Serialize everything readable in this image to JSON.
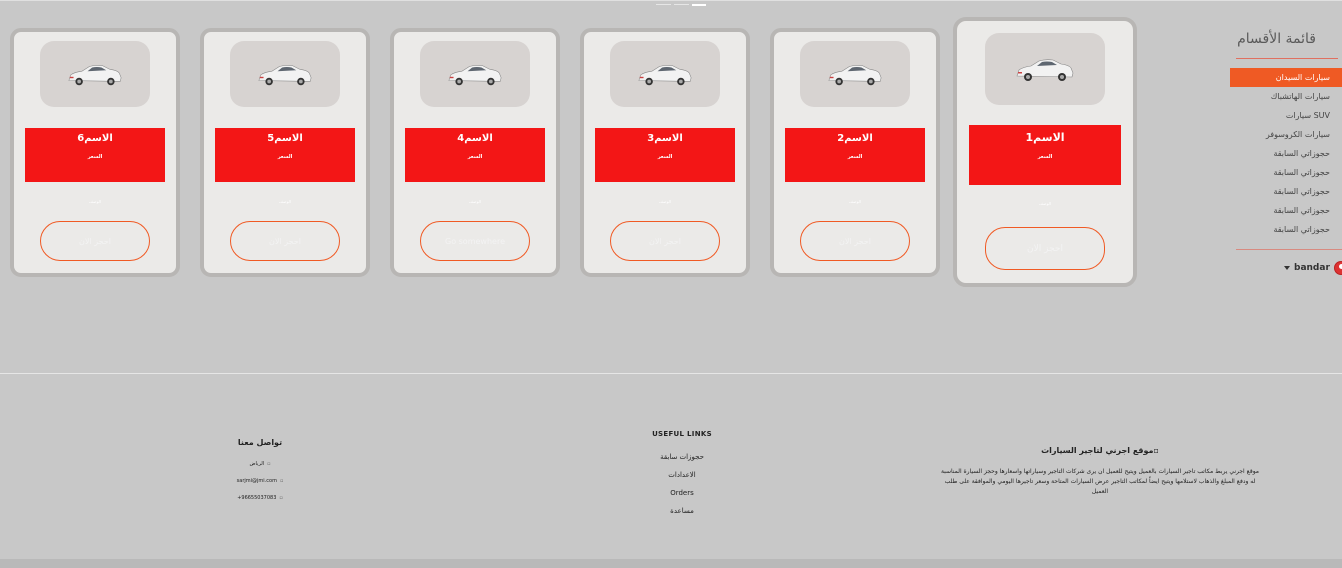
{
  "sidebar": {
    "title": "قائمة الأقسام",
    "items": [
      {
        "label": "سيارات السيدان",
        "active": true
      },
      {
        "label": "سيارات الهاتشباك",
        "active": false
      },
      {
        "label": "سيارات SUV",
        "active": false
      },
      {
        "label": "سيارات الكروسوفر",
        "active": false
      },
      {
        "label": "حجوزاتي السابقة",
        "active": false
      },
      {
        "label": "حجوزاتي السابقة",
        "active": false
      },
      {
        "label": "حجوزاتي السابقة",
        "active": false
      },
      {
        "label": "حجوزاتي السابقة",
        "active": false
      },
      {
        "label": "حجوزاتي السابقة",
        "active": false
      }
    ]
  },
  "user": {
    "name": "bandar",
    "avatar_icon": "user-avatar-icon",
    "dropdown_icon": "caret-down-icon"
  },
  "cards": [
    {
      "name": "الاسم1",
      "price": "السعر",
      "desc": "الوصف",
      "button": "احجز الان"
    },
    {
      "name": "الاسم2",
      "price": "السعر",
      "desc": "الوصف",
      "button": "احجز الان"
    },
    {
      "name": "الاسم3",
      "price": "السعر",
      "desc": "الوصف",
      "button": "احجز الان"
    },
    {
      "name": "الاسم4",
      "price": "السعر",
      "desc": "الوصف",
      "button": "Go somewhere"
    },
    {
      "name": "الاسم5",
      "price": "السعر",
      "desc": "الوصف",
      "button": "احجز الان"
    },
    {
      "name": "الاسم6",
      "price": "السعر",
      "desc": "الوصف",
      "button": "احجز الان"
    }
  ],
  "footer": {
    "about": {
      "title": "موقع اجرني لتاجير السيارات",
      "text": "موقع اجرني يربط مكاتب تاجير السيارات بالعميل ويتيح للعميل ان يرى شركات التاجير وسياراتها واسعارها وحجز السيارة المناسبة له ودفع المبلغ والذهاب لاستلامها ويتيح ايضاً لمكاتب التاجير عرض السيارات المتاحة وسعر تاجيرها اليومي والموافقة على طلب العميل"
    },
    "links": {
      "title": "USEFUL LINKS",
      "items": [
        "حجوزات سابقة",
        "الاعدادات",
        "Orders",
        "مساعدة"
      ]
    },
    "contact": {
      "title": "تواصل معنا",
      "items": [
        "الرياض",
        "sarjmi@jmi.com",
        "+96655037083"
      ]
    }
  },
  "colors": {
    "accent": "#f31616",
    "orange": "#ef5a24",
    "background": "#c8c8c8",
    "card": "#ebeae8"
  }
}
